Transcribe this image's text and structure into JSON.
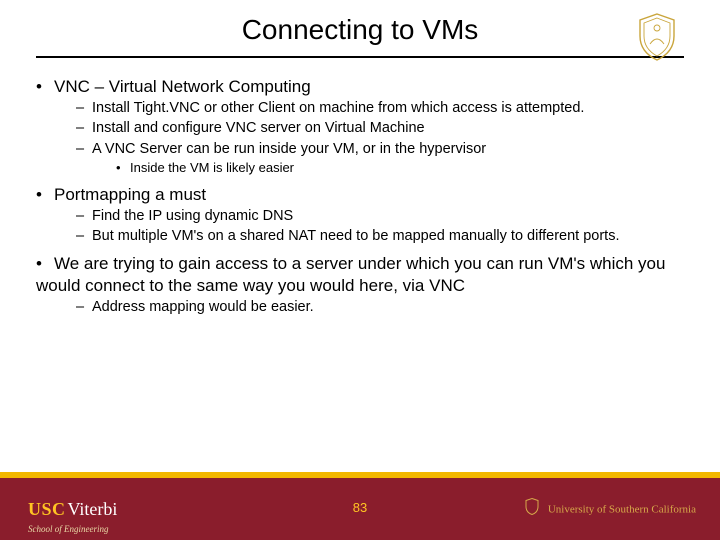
{
  "title": "Connecting to VMs",
  "b0_0": "VNC – Virtual Network Computing",
  "b1_0": "Install Tight.VNC or other Client on machine from which access is attempted.",
  "b1_1": "Install and configure VNC server on Virtual Machine",
  "b1_2": "A VNC Server can be run inside your VM, or in the hypervisor",
  "b2_0": "Inside the VM is likely easier",
  "b0_1": "Portmapping a must",
  "b1_3": "Find the IP using dynamic DNS",
  "b1_4": "But multiple VM's on a shared NAT need to be mapped manually to different ports.",
  "b0_2": "We are trying to gain access to a server under which you can run VM's which you would connect to the same way you would here, via VNC",
  "b1_5": "Address mapping would be easier.",
  "page_number": "83",
  "footer_usc": "USC",
  "footer_viterbi": "Viterbi",
  "footer_school": "School of Engineering",
  "footer_university": "University of Southern California"
}
